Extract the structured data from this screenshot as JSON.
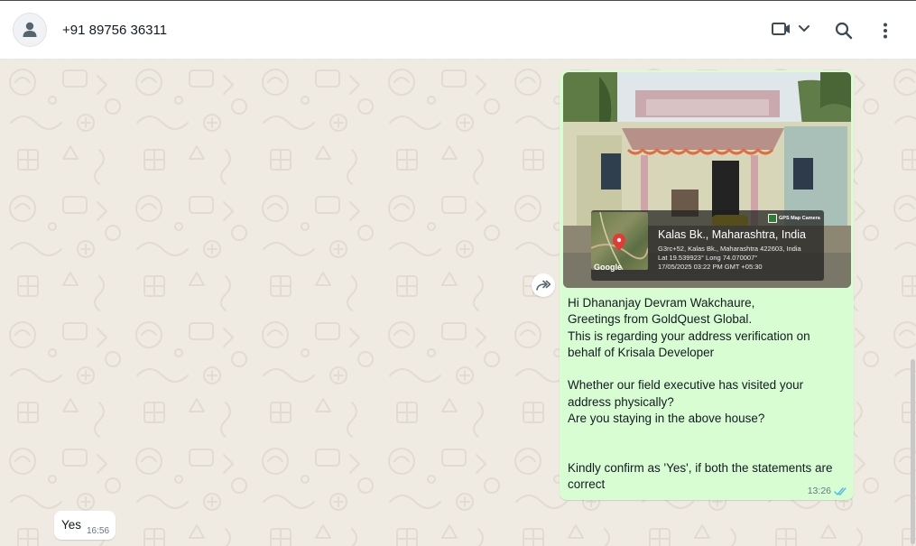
{
  "header": {
    "contact_name": "+91 89756 36311",
    "icons": [
      "person-icon",
      "video-call-icon",
      "chevron-down-icon",
      "search-icon",
      "more-options-icon"
    ]
  },
  "outgoing_message": {
    "photo": {
      "location_title": "Kalas Bk., Maharashtra, India",
      "address_line": "G3rc+52, Kalas Bk., Maharashtra 422603, India",
      "coords_line": "Lat 19.539923° Long 74.070007°",
      "datetime_line": "17/05/2025 03:22 PM GMT +05:30",
      "badge": "GPS Map Camera",
      "map_label": "Google"
    },
    "text": "Hi Dhananjay Devram Wakchaure,\nGreetings from GoldQuest Global.\nThis is regarding your address verification on behalf of Krisala Developer\n\nWhether our field executive has visited your address physically?\nAre you staying in the above house?\n\n\nKindly confirm as 'Yes', if both the statements are correct",
    "time": "13:26",
    "status": "read"
  },
  "incoming_message": {
    "text": "Yes",
    "time": "16:56"
  },
  "colors": {
    "outgoing_bubble": "#d9fdd3",
    "incoming_bubble": "#ffffff",
    "chat_background": "#efeae2",
    "read_ticks": "#53bdeb"
  }
}
